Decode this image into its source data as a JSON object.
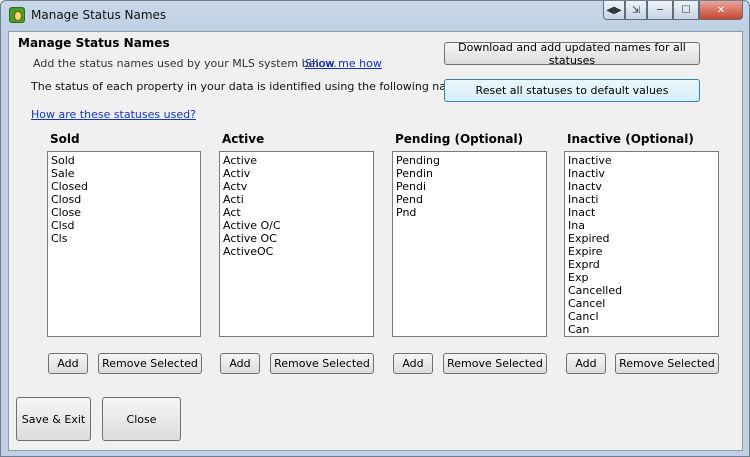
{
  "window": {
    "title": "Manage Status Names",
    "caption": {
      "extra1": "◀▶",
      "extra2": "⇲",
      "minimize": "─",
      "maximize": "☐",
      "close": "✕"
    }
  },
  "header": {
    "heading": "Manage Status Names",
    "subtext": "Add the status names used by your MLS system below.",
    "show_me_link": "Show me how",
    "info": "The status of each property in your data is identified using the following names.",
    "how_link": "How are these statuses used?"
  },
  "actions": {
    "download_label": "Download and add updated names for all statuses",
    "reset_label": "Reset all statuses to default values"
  },
  "groups": [
    {
      "label": "Sold",
      "items": [
        "Sold",
        "Sale",
        "Closed",
        "Closd",
        "Close",
        "Clsd",
        "Cls"
      ]
    },
    {
      "label": "Active",
      "items": [
        "Active",
        "Activ",
        "Actv",
        "Acti",
        "Act",
        "Active O/C",
        "Active OC",
        "ActiveOC"
      ]
    },
    {
      "label": "Pending (Optional)",
      "items": [
        "Pending",
        "Pendin",
        "Pendi",
        "Pend",
        "Pnd"
      ]
    },
    {
      "label": "Inactive (Optional)",
      "items": [
        "Inactive",
        "Inactiv",
        "Inactv",
        "Inacti",
        "Inact",
        "Ina",
        "Expired",
        "Expire",
        "Exprd",
        "Exp",
        "Cancelled",
        "Cancel",
        "Cancl",
        "Can"
      ]
    }
  ],
  "group_buttons": {
    "add_label": "Add",
    "remove_label": "Remove Selected"
  },
  "footer": {
    "save_label": "Save & Exit",
    "close_label": "Close"
  }
}
